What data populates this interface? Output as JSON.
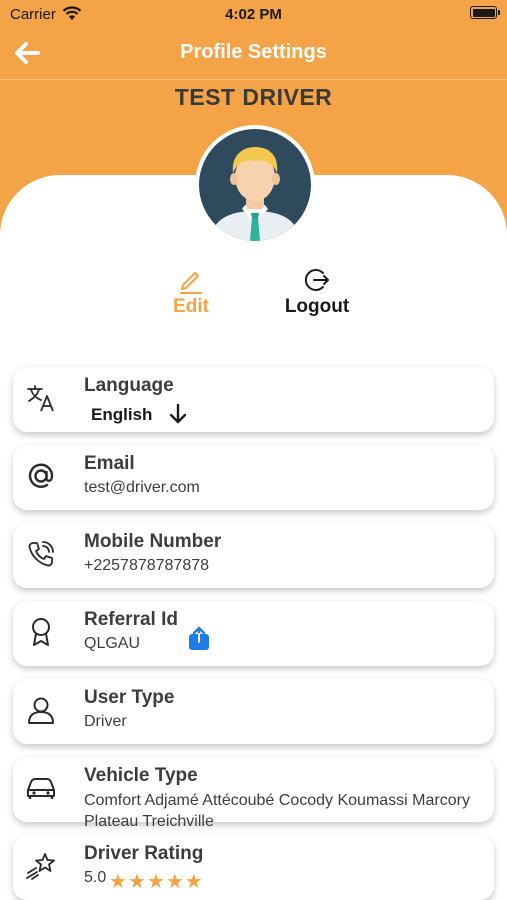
{
  "status_bar": {
    "carrier": "Carrier",
    "time": "4:02 PM"
  },
  "nav": {
    "title": "Profile Settings"
  },
  "profile": {
    "name": "TEST DRIVER"
  },
  "actions": {
    "edit_label": "Edit",
    "logout_label": "Logout"
  },
  "colors": {
    "accent": "#F5A347",
    "share_icon": "#1E7BE8"
  },
  "fields": {
    "language": {
      "title": "Language",
      "value": "English",
      "icon": "translate-icon"
    },
    "email": {
      "title": "Email",
      "value": "test@driver.com",
      "icon": "at-icon"
    },
    "mobile": {
      "title": "Mobile Number",
      "value": "+2257878787878",
      "icon": "phone-icon"
    },
    "referral": {
      "title": "Referral Id",
      "value": "QLGAU",
      "icon": "award-icon"
    },
    "user_type": {
      "title": "User Type",
      "value": "Driver",
      "icon": "user-icon"
    },
    "vehicle": {
      "title": "Vehicle Type",
      "value": "Comfort Adjamé Attécoubé Cocody Koumassi Marcory Plateau Treichville",
      "icon": "car-icon"
    },
    "rating": {
      "title": "Driver Rating",
      "value": "5.0",
      "stars": 5,
      "icon": "rating-star-icon"
    }
  }
}
